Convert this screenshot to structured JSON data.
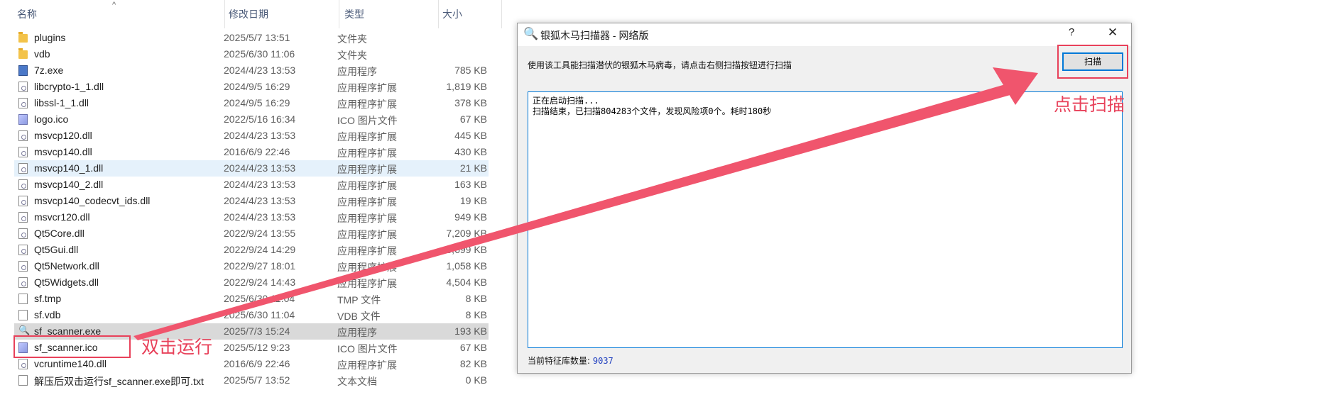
{
  "explorer": {
    "columns": {
      "name": "名称",
      "modified": "修改日期",
      "type": "类型",
      "size": "大小"
    },
    "files": [
      {
        "name": "plugins",
        "modified": "2025/5/7 13:51",
        "type": "文件夹",
        "size": "",
        "icon": "folder-icon"
      },
      {
        "name": "vdb",
        "modified": "2025/6/30 11:06",
        "type": "文件夹",
        "size": "",
        "icon": "folder-icon"
      },
      {
        "name": "7z.exe",
        "modified": "2024/4/23 13:53",
        "type": "应用程序",
        "size": "785 KB",
        "icon": "exe-icon"
      },
      {
        "name": "libcrypto-1_1.dll",
        "modified": "2024/9/5 16:29",
        "type": "应用程序扩展",
        "size": "1,819 KB",
        "icon": "dll-icon"
      },
      {
        "name": "libssl-1_1.dll",
        "modified": "2024/9/5 16:29",
        "type": "应用程序扩展",
        "size": "378 KB",
        "icon": "dll-icon"
      },
      {
        "name": "logo.ico",
        "modified": "2022/5/16 16:34",
        "type": "ICO 图片文件",
        "size": "67 KB",
        "icon": "ico-file-icon"
      },
      {
        "name": "msvcp120.dll",
        "modified": "2024/4/23 13:53",
        "type": "应用程序扩展",
        "size": "445 KB",
        "icon": "dll-icon"
      },
      {
        "name": "msvcp140.dll",
        "modified": "2016/6/9 22:46",
        "type": "应用程序扩展",
        "size": "430 KB",
        "icon": "dll-icon"
      },
      {
        "name": "msvcp140_1.dll",
        "modified": "2024/4/23 13:53",
        "type": "应用程序扩展",
        "size": "21 KB",
        "icon": "dll-icon"
      },
      {
        "name": "msvcp140_2.dll",
        "modified": "2024/4/23 13:53",
        "type": "应用程序扩展",
        "size": "163 KB",
        "icon": "dll-icon"
      },
      {
        "name": "msvcp140_codecvt_ids.dll",
        "modified": "2024/4/23 13:53",
        "type": "应用程序扩展",
        "size": "19 KB",
        "icon": "dll-icon"
      },
      {
        "name": "msvcr120.dll",
        "modified": "2024/4/23 13:53",
        "type": "应用程序扩展",
        "size": "949 KB",
        "icon": "dll-icon"
      },
      {
        "name": "Qt5Core.dll",
        "modified": "2022/9/24 13:55",
        "type": "应用程序扩展",
        "size": "7,209 KB",
        "icon": "dll-icon"
      },
      {
        "name": "Qt5Gui.dll",
        "modified": "2022/9/24 14:29",
        "type": "应用程序扩展",
        "size": "5,699 KB",
        "icon": "dll-icon"
      },
      {
        "name": "Qt5Network.dll",
        "modified": "2022/9/27 18:01",
        "type": "应用程序扩展",
        "size": "1,058 KB",
        "icon": "dll-icon"
      },
      {
        "name": "Qt5Widgets.dll",
        "modified": "2022/9/24 14:43",
        "type": "应用程序扩展",
        "size": "4,504 KB",
        "icon": "dll-icon"
      },
      {
        "name": "sf.tmp",
        "modified": "2025/6/30 11:04",
        "type": "TMP 文件",
        "size": "8 KB",
        "icon": "file-icon"
      },
      {
        "name": "sf.vdb",
        "modified": "2025/6/30 11:04",
        "type": "VDB 文件",
        "size": "8 KB",
        "icon": "file-icon"
      },
      {
        "name": "sf_scanner.exe",
        "modified": "2025/7/3 15:24",
        "type": "应用程序",
        "size": "193 KB",
        "icon": "magnifier-icon"
      },
      {
        "name": "sf_scanner.ico",
        "modified": "2025/5/12 9:23",
        "type": "ICO 图片文件",
        "size": "67 KB",
        "icon": "ico-file-icon"
      },
      {
        "name": "vcruntime140.dll",
        "modified": "2016/6/9 22:46",
        "type": "应用程序扩展",
        "size": "82 KB",
        "icon": "dll-icon"
      },
      {
        "name": "解压后双击运行sf_scanner.exe即可.txt",
        "modified": "2025/5/7 13:52",
        "type": "文本文档",
        "size": "0 KB",
        "icon": "text-file-icon"
      }
    ],
    "hover_row": "msvcp140_1.dll",
    "selected_row": "sf_scanner.exe"
  },
  "annotations": {
    "run_note": "双击运行",
    "click_note": "点击扫描",
    "color": "#e8415a"
  },
  "dialog": {
    "title": "银狐木马扫描器 - 网络版",
    "help": "?",
    "close": "✕",
    "instruction": "使用该工具能扫描潜伏的银狐木马病毒，请点击右侧扫描按钮进行扫描",
    "scan_button": "扫描",
    "log_lines": [
      "正在启动扫描...",
      "扫描结束，已扫描804283个文件，发现风险项0个。耗时180秒"
    ],
    "status_label": "当前特征库数量:",
    "status_value": "9037"
  }
}
